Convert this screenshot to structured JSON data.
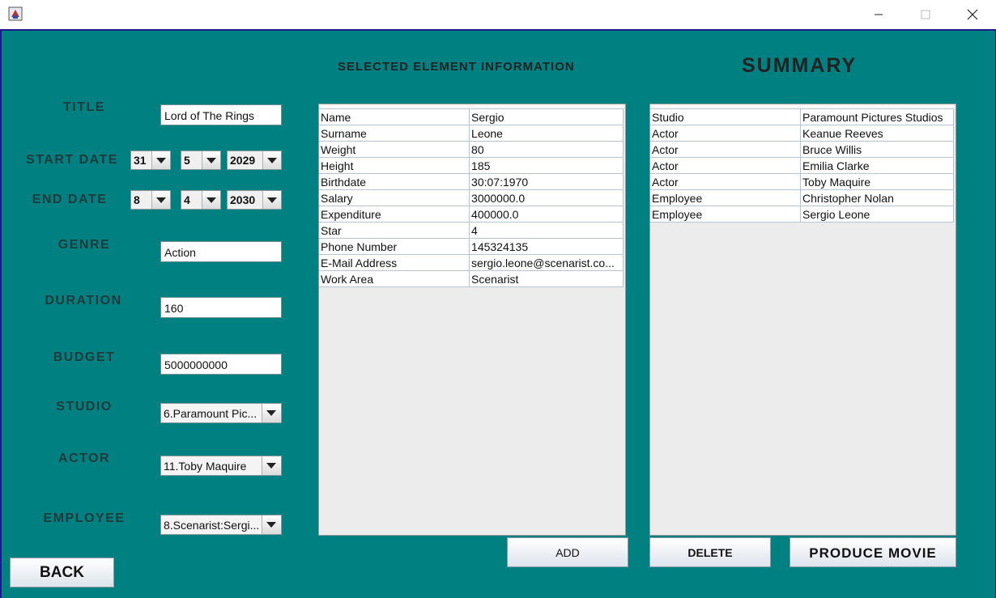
{
  "window": {
    "icon": "java-app-icon",
    "minimize_icon": "minimize-icon",
    "maximize_icon": "maximize-icon",
    "close_icon": "close-icon"
  },
  "form": {
    "title": {
      "label": "TITLE",
      "value": "Lord of The Rings"
    },
    "start_date": {
      "label": "START DATE",
      "day": "31",
      "month": "5",
      "year": "2029"
    },
    "end_date": {
      "label": "END DATE",
      "day": "8",
      "month": "4",
      "year": "2030"
    },
    "genre": {
      "label": "GENRE",
      "value": "Action"
    },
    "duration": {
      "label": "DURATION",
      "value": "160"
    },
    "budget": {
      "label": "BUDGET",
      "value": "5000000000"
    },
    "studio": {
      "label": "STUDIO",
      "value": "6.Paramount Pic..."
    },
    "actor": {
      "label": "ACTOR",
      "value": "11.Toby Maquire"
    },
    "employee": {
      "label": "EMPLOYEE",
      "value": "8.Scenarist:Sergi..."
    }
  },
  "selected": {
    "heading": "SELECTED ELEMENT INFORMATION",
    "rows": [
      [
        "Name",
        "Sergio"
      ],
      [
        "Surname",
        "Leone"
      ],
      [
        "Weight",
        "80"
      ],
      [
        "Height",
        "185"
      ],
      [
        "Birthdate",
        "30:07:1970"
      ],
      [
        "Salary",
        "3000000.0"
      ],
      [
        "Expenditure",
        "400000.0"
      ],
      [
        "Star",
        "4"
      ],
      [
        "Phone Number",
        "145324135"
      ],
      [
        "E-Mail Address",
        "sergio.leone@scenarist.co..."
      ],
      [
        "Work Area",
        "Scenarist"
      ]
    ]
  },
  "summary": {
    "heading": "SUMMARY",
    "rows": [
      [
        "Studio",
        "Paramount Pictures Studios"
      ],
      [
        "Actor",
        "Keanue Reeves"
      ],
      [
        "Actor",
        "Bruce Willis"
      ],
      [
        "Actor",
        "Emilia Clarke"
      ],
      [
        "Actor",
        "Toby Maquire"
      ],
      [
        "Employee",
        "Christopher Nolan"
      ],
      [
        "Employee",
        "Sergio Leone"
      ]
    ]
  },
  "buttons": {
    "back": "BACK",
    "add": "ADD",
    "delete": "DELETE",
    "produce": "PRODUCE MOVIE"
  },
  "colors": {
    "background": "#008080",
    "label_text": "#1f3a3a"
  }
}
